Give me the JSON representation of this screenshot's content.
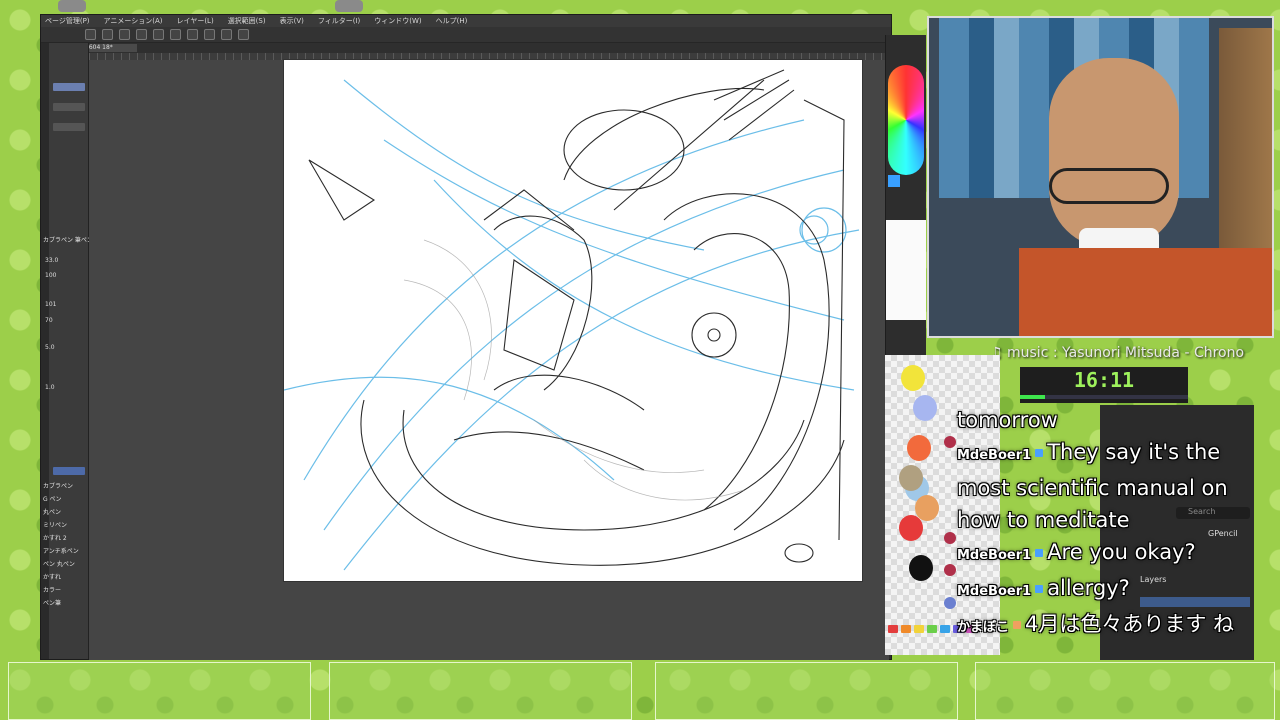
{
  "app": {
    "menu": [
      "ページ管理(P)",
      "アニメーション(A)",
      "レイヤー(L)",
      "選択範囲(S)",
      "表示(V)",
      "フィルター(I)",
      "ウィンドウ(W)",
      "ヘルプ(H)"
    ],
    "tab_label": "2604 18*"
  },
  "left_panel": {
    "brush_panel_title": "カブラペン 筆ペン",
    "values": [
      "33.0",
      "100",
      "101",
      "70",
      "5.0",
      "1.0"
    ],
    "tools": [
      "カブラペン",
      "G ペン",
      "丸ペン",
      "ミリペン",
      "かすれ 2",
      "アンチ系ペン",
      "ペン 丸ペン",
      "かすれ",
      "カラー",
      "ペン筆"
    ]
  },
  "stream": {
    "music_label": "♫ music : Yasunori Mitsuda - Chrono",
    "timer": "16:11",
    "timer_progress": 0.15,
    "blender": {
      "search_placeholder": "Search",
      "item": "GPencil",
      "layers_label": "Layers"
    }
  },
  "chat": [
    {
      "user": "",
      "message": "tomorrow"
    },
    {
      "user": "MdeBoer1",
      "message": "They say it's the most scientific manual on how to meditate"
    },
    {
      "user": "MdeBoer1",
      "message": "Are you okay?"
    },
    {
      "user": "MdeBoer1",
      "message": "allergy?"
    },
    {
      "user": "かまぼこ",
      "message": "4月は色々あります ね"
    }
  ],
  "palette_colors": [
    "#f2e43a",
    "#a7b6f0",
    "#f26a3c",
    "#a0c8e8",
    "#e8a060",
    "#e63a3a",
    "#111111",
    "#b0a080"
  ],
  "swatch_colors": [
    "#e33d3d",
    "#f08a2a",
    "#f2d33a",
    "#6bcf4a",
    "#38a3e8",
    "#6a5de0",
    "#d055c0",
    "#ffffff"
  ]
}
